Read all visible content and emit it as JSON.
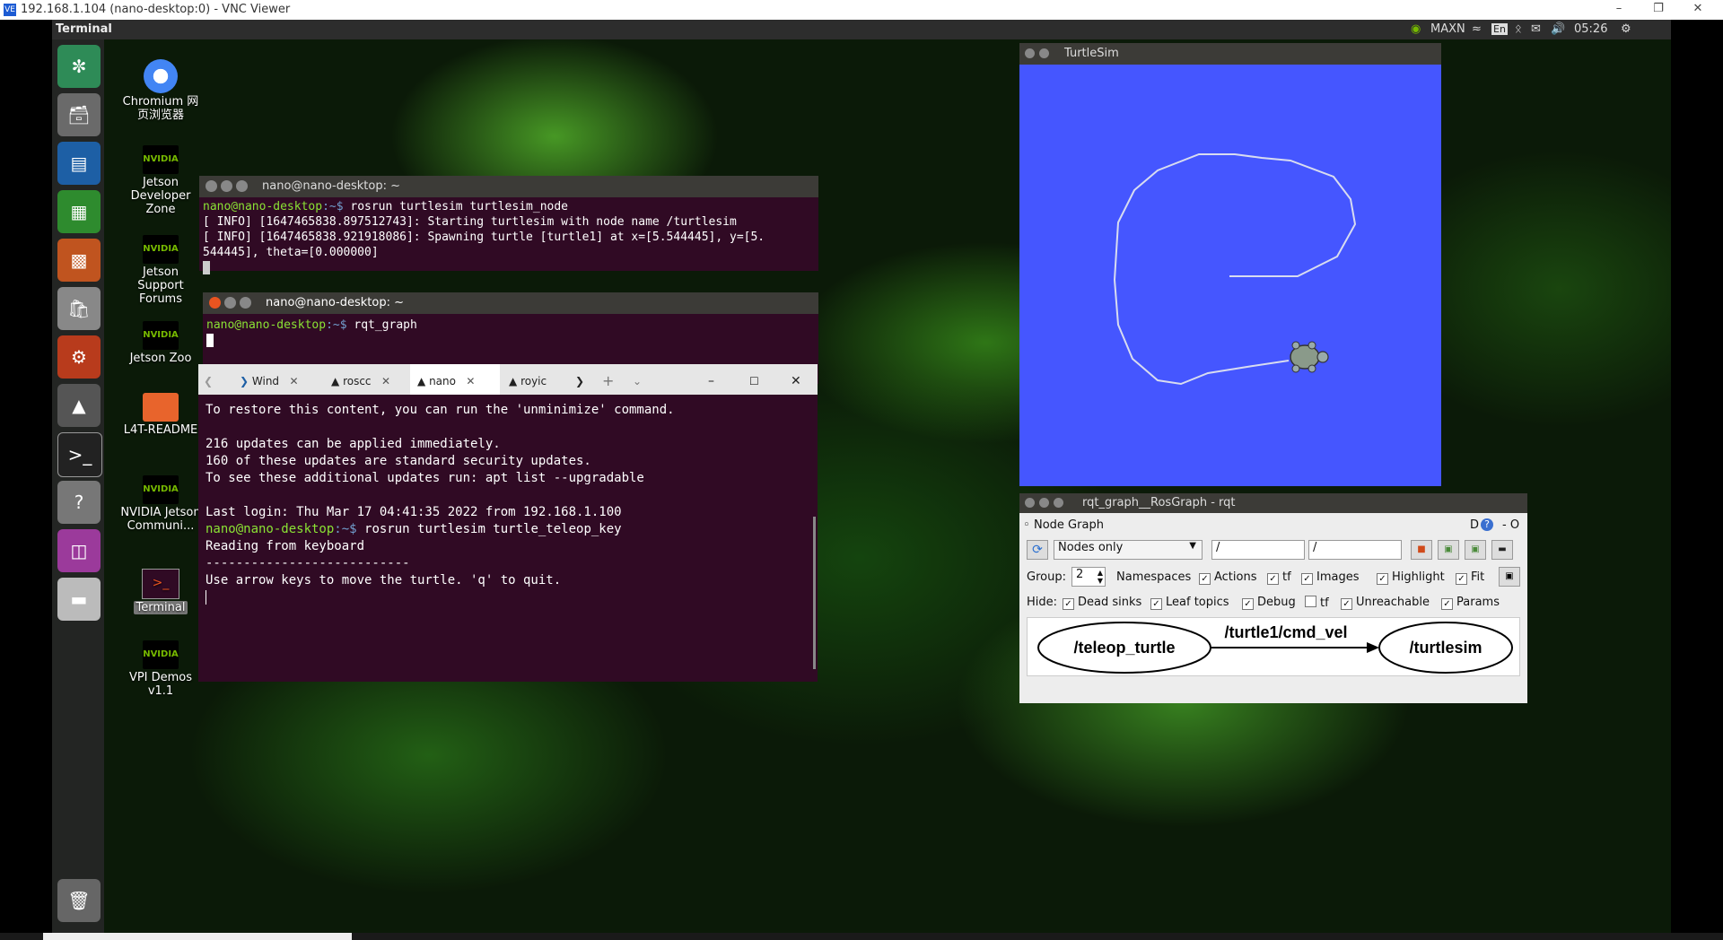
{
  "vnc": {
    "title": "192.168.1.104 (nano-desktop:0) - VNC Viewer",
    "icon": "VE"
  },
  "topbar": {
    "app_name": "Terminal",
    "power_mode": "MAXN",
    "keyboard": "En",
    "time": "05:26"
  },
  "desktop_icons": [
    {
      "label": "Chromium 网页浏览器"
    },
    {
      "label": "Jetson Developer Zone"
    },
    {
      "label": "Jetson Support Forums"
    },
    {
      "label": "Jetson Zoo"
    },
    {
      "label": "L4T-README"
    },
    {
      "label": "NVIDIA Jetson Communi..."
    },
    {
      "label": "Terminal"
    },
    {
      "label": "VPI Demos v1.1"
    }
  ],
  "nvidia_badge": "NVIDIA",
  "term1": {
    "title": "nano@nano-desktop: ~",
    "prompt_user": "nano@nano-desktop",
    "prompt_path": ":~$ ",
    "command": "rosrun turtlesim turtlesim_node",
    "output": "[ INFO] [1647465838.897512743]: Starting turtlesim with node name /turtlesim\n[ INFO] [1647465838.921918086]: Spawning turtle [turtle1] at x=[5.544445], y=[5.\n544445], theta=[0.000000]"
  },
  "term2": {
    "title": "nano@nano-desktop: ~",
    "prompt_user": "nano@nano-desktop",
    "prompt_path": ":~$ ",
    "command": "rqt_graph"
  },
  "wt": {
    "tabs": [
      "Wind",
      "roscc",
      "nano",
      "royic"
    ],
    "output_top": "To restore this content, you can run the 'unminimize' command.\n\n216 updates can be applied immediately.\n160 of these updates are standard security updates.\nTo see these additional updates run: apt list --upgradable\n\nLast login: Thu Mar 17 04:41:35 2022 from 192.168.1.100",
    "prompt_user": "nano@nano-desktop",
    "prompt_path": ":~$ ",
    "command": "rosrun turtlesim turtle_teleop_key",
    "output_bottom": "Reading from keyboard\n---------------------------\nUse arrow keys to move the turtle. 'q' to quit."
  },
  "turtlesim": {
    "title": "TurtleSim",
    "bg_color": "#4556ff"
  },
  "rqt": {
    "title": "rqt_graph__RosGraph - rqt",
    "plugin_title": "Node Graph",
    "corner_labels": [
      "D",
      "?",
      "- O"
    ],
    "mode": "Nodes only",
    "ns_filter": "/",
    "topic_filter": "/",
    "group_label": "Group:",
    "group_value": "2",
    "group_options": [
      "Namespaces",
      "Actions",
      "tf",
      "Images",
      "Highlight",
      "Fit"
    ],
    "hide_label": "Hide:",
    "hide_options": [
      "Dead sinks",
      "Leaf topics",
      "Debug",
      "tf",
      "Unreachable",
      "Params"
    ],
    "graph": {
      "node_a": "/teleop_turtle",
      "edge": "/turtle1/cmd_vel",
      "node_b": "/turtlesim"
    }
  }
}
